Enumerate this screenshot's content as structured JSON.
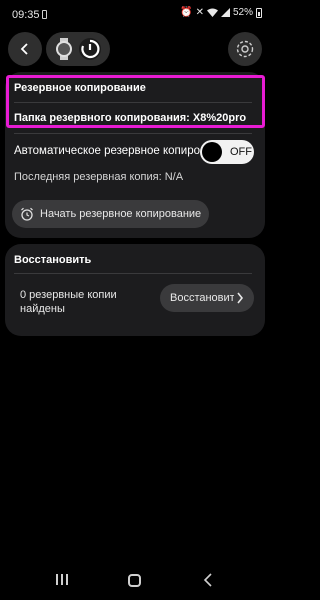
{
  "status_bar": {
    "time": "09:35",
    "battery_percent": "52%",
    "icons": [
      "battery-saver-icon",
      "alarm-icon",
      "mute-icon",
      "wifi-icon",
      "signal-icon",
      "battery-icon"
    ]
  },
  "header": {
    "back_icon": "back-arrow-icon",
    "device_icons": [
      "watch-icon",
      "power-sync-icon"
    ],
    "settings_icon": "settings-circle-icon"
  },
  "backup_card": {
    "title": "Резервное копирование",
    "folder_label": "Папка резервного копирования: X8%20pro",
    "auto_backup_label": "Автоматическое резервное копирование",
    "auto_backup_toggle": {
      "state_label": "OFF",
      "on": false
    },
    "last_backup": "Последняя резервная копия: N/A",
    "start_button": {
      "icon": "alarm-clock-icon",
      "label": "Начать резервное копирование"
    }
  },
  "restore_card": {
    "title": "Восстановить",
    "status": "0 резервные копии найдены",
    "restore_button": {
      "label": "Восстановить",
      "icon": "chevron-right-icon"
    }
  },
  "highlight_color": "#e81cd4",
  "nav_bar": {
    "icons": [
      "recents-icon",
      "home-icon",
      "back-icon"
    ]
  }
}
